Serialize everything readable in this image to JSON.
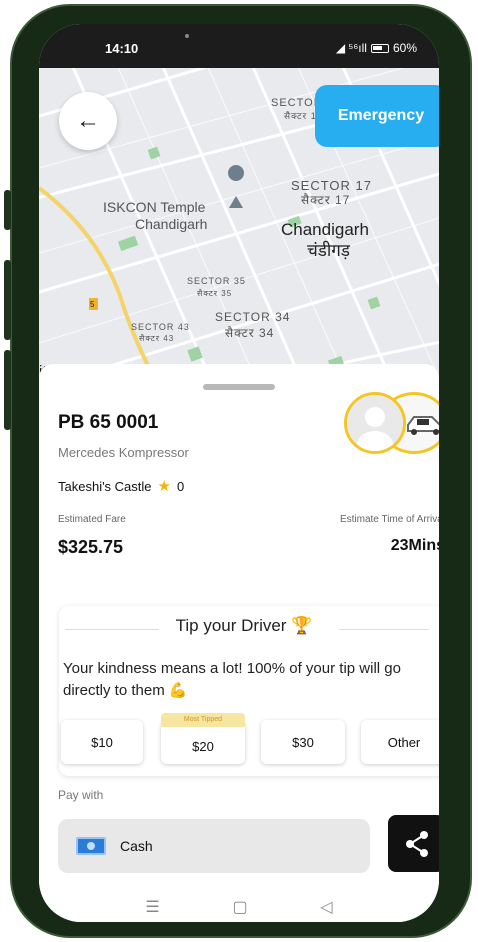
{
  "status": {
    "time": "14:10",
    "signal": "◢ ⁵⁶ıll",
    "battery": "60%"
  },
  "map": {
    "labels": [
      "SECTOR",
      "सैक्टर 1",
      "SECTOR 17",
      "सैक्टर 17",
      "ISKCON Temple",
      "Chandigarh",
      "Chandigarh",
      "चंडीगड़",
      "SECTOR 35",
      "सैक्टर 35",
      "SECTOR 34",
      "सैक्टर 34",
      "SECTOR 43",
      "सैक्टर 43",
      "5",
      "it"
    ]
  },
  "header": {
    "back_icon": "←",
    "emergency_label": "Emergency"
  },
  "driver": {
    "plate": "PB 65 0001",
    "car_model": "Mercedes Kompressor",
    "name": "Takeshi's Castle",
    "rating": "0"
  },
  "fare": {
    "fare_label": "Estimated Fare",
    "fare_value": "$325.75",
    "eta_label": "Estimate Time of Arrival",
    "eta_value": "23Mins"
  },
  "tip": {
    "title": "Tip your Driver 🏆",
    "message": "Your kindness means a lot! 100% of your tip will go directly to them 💪",
    "badge": "Most Tipped",
    "options": [
      "$10",
      "$20",
      "$30",
      "Other"
    ]
  },
  "payment": {
    "pay_with_label": "Pay with",
    "method": "Cash"
  },
  "colors": {
    "accent": "#27aef0",
    "ring": "#f3c623"
  }
}
